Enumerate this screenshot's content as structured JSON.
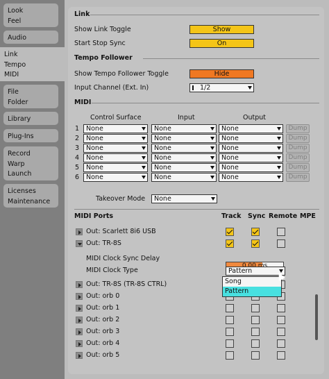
{
  "nav": {
    "items": [
      {
        "lines": [
          "Look",
          "Feel"
        ]
      },
      {
        "lines": [
          "Audio"
        ]
      },
      {
        "lines": [
          "Link",
          "Tempo",
          "MIDI"
        ]
      },
      {
        "lines": [
          "File",
          "Folder"
        ]
      },
      {
        "lines": [
          "Library"
        ]
      },
      {
        "lines": [
          "Plug-Ins"
        ]
      },
      {
        "lines": [
          "Record",
          "Warp",
          "Launch"
        ]
      },
      {
        "lines": [
          "Licenses",
          "Maintenance"
        ]
      }
    ]
  },
  "link": {
    "title": "Link",
    "show_toggle_label": "Show Link Toggle",
    "show_toggle_value": "Show",
    "start_stop_label": "Start Stop Sync",
    "start_stop_value": "On"
  },
  "tempo": {
    "title": "Tempo Follower",
    "show_label": "Show Tempo Follower Toggle",
    "show_value": "Hide",
    "channel_label": "Input Channel (Ext. In)",
    "channel_value": "1/2"
  },
  "midi": {
    "title": "MIDI",
    "col_control": "Control Surface",
    "col_input": "Input",
    "col_output": "Output",
    "rows": [
      {
        "num": "1",
        "control": "None",
        "input": "None",
        "output": "None",
        "dump": "Dump"
      },
      {
        "num": "2",
        "control": "None",
        "input": "None",
        "output": "None",
        "dump": "Dump"
      },
      {
        "num": "3",
        "control": "None",
        "input": "None",
        "output": "None",
        "dump": "Dump"
      },
      {
        "num": "4",
        "control": "None",
        "input": "None",
        "output": "None",
        "dump": "Dump"
      },
      {
        "num": "5",
        "control": "None",
        "input": "None",
        "output": "None",
        "dump": "Dump"
      },
      {
        "num": "6",
        "control": "None",
        "input": "None",
        "output": "None",
        "dump": "Dump"
      }
    ],
    "takeover_label": "Takeover Mode",
    "takeover_value": "None"
  },
  "ports": {
    "title": "MIDI Ports",
    "col_track": "Track",
    "col_sync": "Sync",
    "col_remote": "Remote",
    "col_mpe": "MPE",
    "sync_delay_label": "MIDI Clock Sync Delay",
    "sync_delay_value": "0.00 ms",
    "clock_type_label": "MIDI Clock Type",
    "clock_type_value": "Pattern",
    "clock_options": [
      "Song",
      "Pattern"
    ],
    "clock_selected": "Pattern",
    "list": [
      {
        "name": "Out: Scarlett 8i6 USB",
        "track": true,
        "sync": true,
        "remote": false
      },
      {
        "name": "Out: TR-8S",
        "track": true,
        "sync": true,
        "remote": false
      },
      {
        "name": "Out: TR-8S (TR-8S CTRL)",
        "track": false,
        "sync": false,
        "remote": false
      },
      {
        "name": "Out: orb 0",
        "track": false,
        "sync": false,
        "remote": false
      },
      {
        "name": "Out: orb 1",
        "track": false,
        "sync": false,
        "remote": false
      },
      {
        "name": "Out: orb 2",
        "track": false,
        "sync": false,
        "remote": false
      },
      {
        "name": "Out: orb 3",
        "track": false,
        "sync": false,
        "remote": false
      },
      {
        "name": "Out: orb 4",
        "track": false,
        "sync": false,
        "remote": false
      },
      {
        "name": "Out: orb 5",
        "track": false,
        "sync": false,
        "remote": false
      }
    ]
  },
  "colors": {
    "toggle_yellow": "#f4c518",
    "toggle_orange": "#f07822",
    "popup_highlight": "#48e0e0"
  }
}
